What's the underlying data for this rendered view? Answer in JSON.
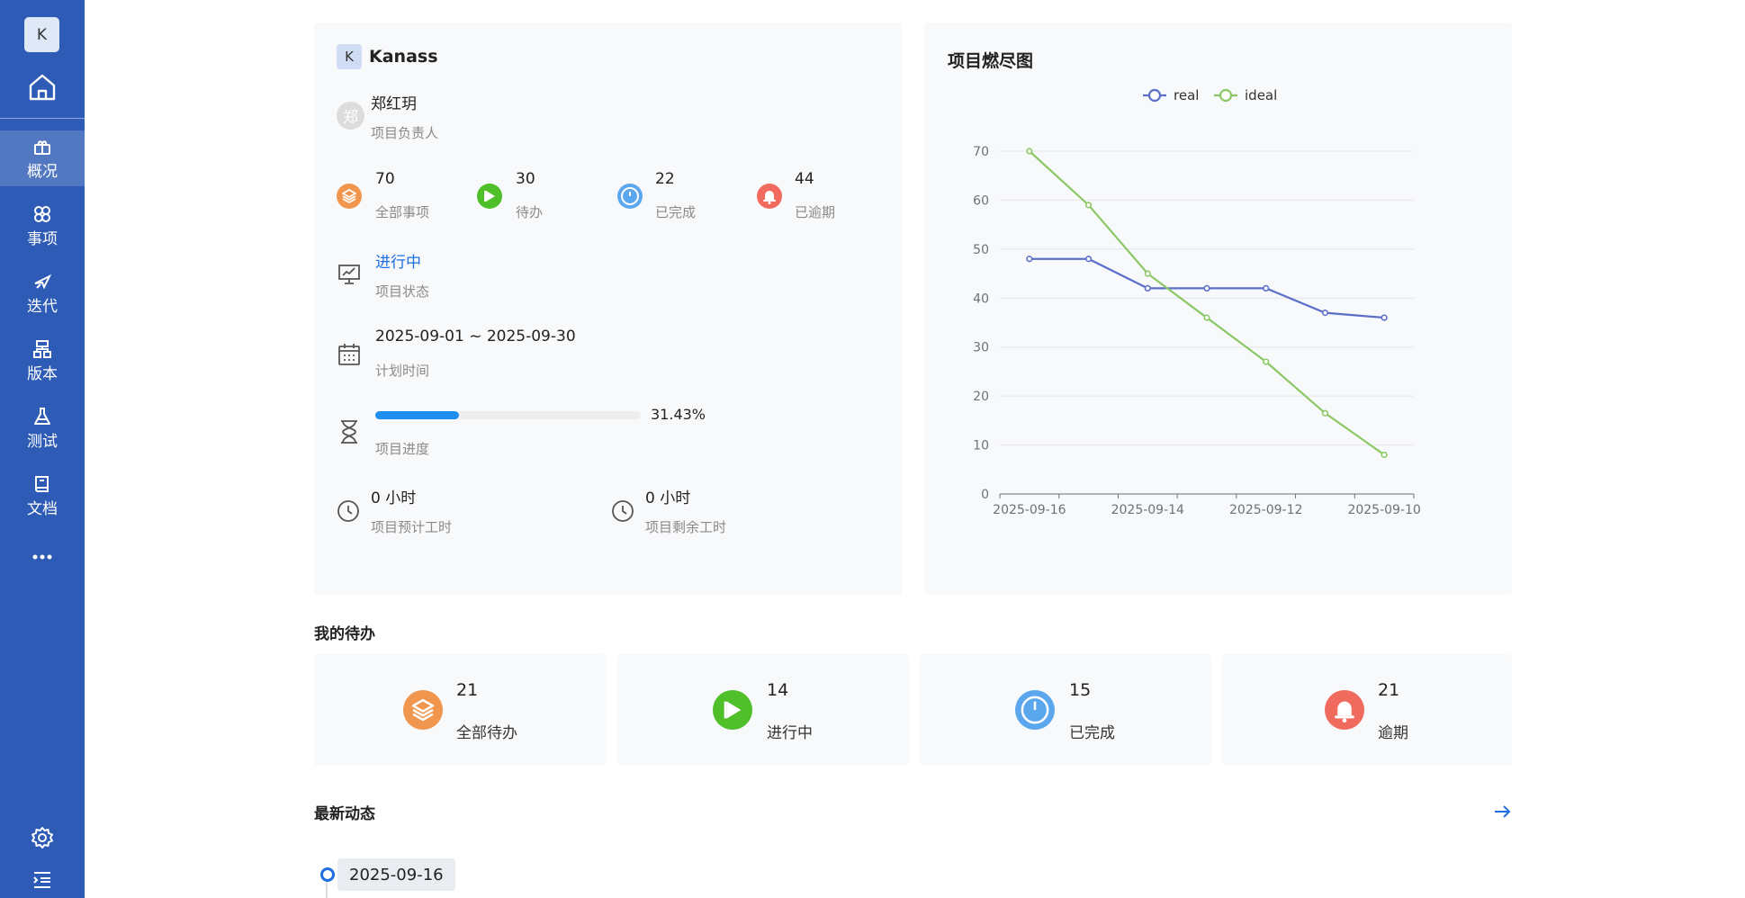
{
  "sidebar": {
    "logo_letter": "K",
    "items": [
      {
        "label": "概况",
        "icon": "overview-icon",
        "active": true
      },
      {
        "label": "事项",
        "icon": "work-item-icon",
        "active": false
      },
      {
        "label": "迭代",
        "icon": "sprint-icon",
        "active": false
      },
      {
        "label": "版本",
        "icon": "version-icon",
        "active": false
      },
      {
        "label": "测试",
        "icon": "test-flask-icon",
        "active": false
      },
      {
        "label": "文档",
        "icon": "document-book-icon",
        "active": false
      }
    ]
  },
  "project": {
    "logo_letter": "K",
    "name": "Kanass",
    "owner_avatar": "郑",
    "owner_name": "郑红玥",
    "owner_label": "项目负责人",
    "stats": [
      {
        "value": "70",
        "label": "全部事项",
        "color": "#f0964e",
        "icon": "layers-icon"
      },
      {
        "value": "30",
        "label": "待办",
        "color": "#4fbf2a",
        "icon": "play-icon"
      },
      {
        "value": "22",
        "label": "已完成",
        "color": "#5ba7ee",
        "icon": "power-icon"
      },
      {
        "value": "44",
        "label": "已逾期",
        "color": "#f06a5e",
        "icon": "bell-icon"
      }
    ],
    "status_value": "进行中",
    "status_label": "项目状态",
    "plan_time_value": "2025-09-01 ~ 2025-09-30",
    "plan_time_label": "计划时间",
    "progress_percent": 31.43,
    "progress_text": "31.43%",
    "progress_label": "项目进度",
    "estimate_value": "0 小时",
    "estimate_label": "项目预计工时",
    "remaining_value": "0 小时",
    "remaining_label": "项目剩余工时"
  },
  "burndown": {
    "title": "项目燃尽图"
  },
  "chart_data": {
    "type": "line",
    "title": "项目燃尽图",
    "categories": [
      "2025-09-16",
      "",
      "2025-09-14",
      "",
      "2025-09-12",
      "",
      "2025-09-10"
    ],
    "series": [
      {
        "name": "real",
        "values": [
          48,
          48,
          42,
          42,
          42,
          37,
          36
        ],
        "color": "#5b6fc8"
      },
      {
        "name": "ideal",
        "values": [
          70,
          59,
          45,
          36,
          27,
          16.5,
          8
        ],
        "color": "#8bc865"
      }
    ],
    "x_tick_labels": [
      "2025-09-16",
      "2025-09-14",
      "2025-09-12",
      "2025-09-10"
    ],
    "y_ticks": [
      0,
      10,
      20,
      30,
      40,
      50,
      60,
      70
    ],
    "ylim": [
      0,
      70
    ],
    "legend": "top-center",
    "grid": true
  },
  "todo": {
    "title": "我的待办",
    "cards": [
      {
        "value": "21",
        "label": "全部待办",
        "color": "#f0964e",
        "icon": "layers-icon"
      },
      {
        "value": "14",
        "label": "进行中",
        "color": "#4fbf2a",
        "icon": "play-icon"
      },
      {
        "value": "15",
        "label": "已完成",
        "color": "#5ba7ee",
        "icon": "power-icon"
      },
      {
        "value": "21",
        "label": "逾期",
        "color": "#f06a5e",
        "icon": "bell-icon"
      }
    ]
  },
  "activity": {
    "title": "最新动态",
    "first_date": "2025-09-16"
  }
}
